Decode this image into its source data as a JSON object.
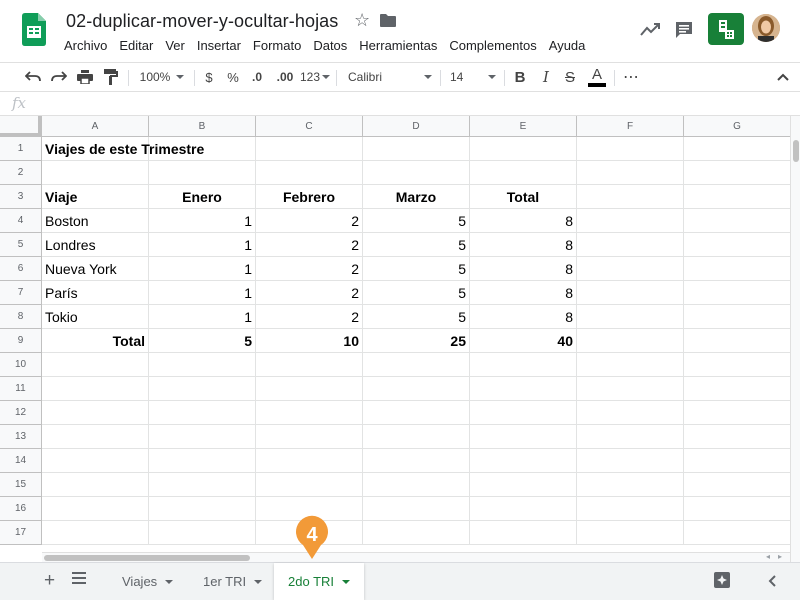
{
  "header": {
    "title": "02-duplicar-mover-y-ocultar-hojas",
    "menu": [
      "Archivo",
      "Editar",
      "Ver",
      "Insertar",
      "Formato",
      "Datos",
      "Herramientas",
      "Complementos",
      "Ayuda"
    ]
  },
  "toolbar": {
    "zoom": "100%",
    "currency": "$",
    "percent": "%",
    "dec_less": ".0",
    "dec_more": ".00",
    "more_formats": "123",
    "font": "Calibri",
    "font_size": "14",
    "bold": "B",
    "italic": "I",
    "strike": "S",
    "text_color": "A",
    "more": "⋯"
  },
  "formula_bar": {
    "label": "fx"
  },
  "columns": [
    "A",
    "B",
    "C",
    "D",
    "E",
    "F",
    "G"
  ],
  "rows": [
    "1",
    "2",
    "3",
    "4",
    "5",
    "6",
    "7",
    "8",
    "9",
    "10",
    "11",
    "12",
    "13",
    "14",
    "15",
    "16",
    "17"
  ],
  "cells": {
    "title": "Viajes de este Trimestre",
    "headers": [
      "Viaje",
      "Enero",
      "Febrero",
      "Marzo",
      "Total"
    ],
    "data": [
      [
        "Boston",
        "1",
        "2",
        "5",
        "8"
      ],
      [
        "Londres",
        "1",
        "2",
        "5",
        "8"
      ],
      [
        "Nueva York",
        "1",
        "2",
        "5",
        "8"
      ],
      [
        "París",
        "1",
        "2",
        "5",
        "8"
      ],
      [
        "Tokio",
        "1",
        "2",
        "5",
        "8"
      ]
    ],
    "totals": [
      "Total",
      "5",
      "10",
      "25",
      "40"
    ]
  },
  "sheets": [
    {
      "name": "Viajes",
      "active": false
    },
    {
      "name": "1er TRI",
      "active": false
    },
    {
      "name": "2do TRI",
      "active": true
    }
  ],
  "step_marker": "4",
  "colors": {
    "accent_green": "#188038",
    "marker_orange": "#f29a38"
  }
}
